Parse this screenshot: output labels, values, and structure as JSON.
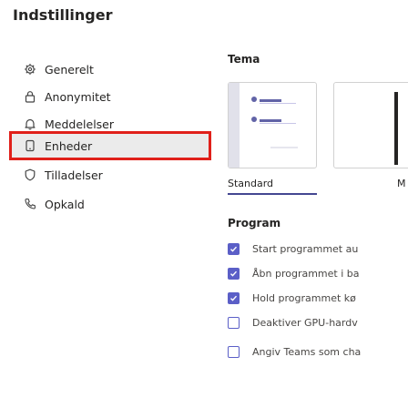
{
  "page": {
    "title": "Indstillinger"
  },
  "sidebar": {
    "items": [
      {
        "label": "Generelt",
        "icon": "gear-icon"
      },
      {
        "label": "Anonymitet",
        "icon": "lock-icon"
      },
      {
        "label": "Meddelelser",
        "icon": "bell-icon"
      },
      {
        "label": "Enheder",
        "icon": "device-icon",
        "selected": true
      },
      {
        "label": "Tilladelser",
        "icon": "shield-icon"
      },
      {
        "label": "Opkald",
        "icon": "phone-icon"
      }
    ]
  },
  "theme": {
    "heading": "Tema",
    "options": [
      {
        "label": "Standard",
        "selected": true
      },
      {
        "label": "M"
      }
    ]
  },
  "program": {
    "heading": "Program",
    "options": [
      {
        "label": "Start programmet au",
        "checked": true
      },
      {
        "label": "Åbn programmet i ba",
        "checked": true
      },
      {
        "label": "Hold programmet kø",
        "checked": true
      },
      {
        "label": "Deaktiver GPU-hardv",
        "checked": false
      },
      {
        "label": "Angiv Teams som cha",
        "checked": false
      }
    ]
  },
  "colors": {
    "accent": "#5b5fc7",
    "selection_border": "#e0201a"
  }
}
